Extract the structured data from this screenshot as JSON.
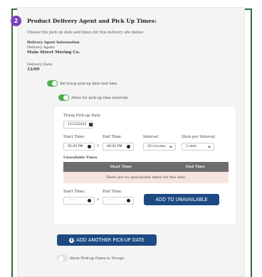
{
  "step": {
    "number": "2",
    "title": "Product Delivery Agent and Pick Up Times:"
  },
  "instructions": "Choose the pick up date and times for this delivery site below:",
  "agent": {
    "heading": "Delivery Agent Information",
    "label": "Delivery Agent:",
    "name": "Main Street Moving Co."
  },
  "delivery": {
    "label": "Delivery Date:",
    "date": "12/09"
  },
  "toggles": {
    "troop_pickup": {
      "label": "Set troop pick-up date and time",
      "on": true
    },
    "intervals": {
      "label": "Allow for pick-up time intervals",
      "on": true
    },
    "show_pickup": {
      "label": "Show Pick-up Dates to Troops",
      "on": false
    }
  },
  "pickup": {
    "date_label": "Troop Pick-up Date",
    "date_value": "12/12/2022",
    "start_label": "Start Time:",
    "end_label": "End Time:",
    "interval_label": "Interval",
    "slots_label": "Slots per Interval",
    "start_value": "05:00 PM",
    "end_value": "06:00 PM",
    "interval_value": "10 minutes",
    "slots_value": "2 slots"
  },
  "unavailable": {
    "heading": "Unavailable Times",
    "col_start": "Start Time",
    "col_end": "End Time",
    "empty_message": "There are no unavailable times for this date.",
    "start_label": "Start Time:",
    "end_label": "End Time:",
    "start_placeholder": "--:-- --",
    "end_placeholder": "--:-- --",
    "add_button": "ADD TO UNAVAILABLE"
  },
  "add_another_button": "ADD ANOTHER PICK-UP DATE",
  "icons": {
    "calendar": "calendar-icon",
    "clock": "clock-icon",
    "plus": "plus-circle-icon",
    "caret": "chevron-down-icon",
    "arrow": "chevron-right-icon"
  },
  "colors": {
    "accent_purple": "#7f3fbf",
    "toggle_green": "#4caf50",
    "button_blue": "#1d4a82",
    "frame_green": "#2e6b3a",
    "empty_row": "#f6e5df",
    "table_header": "#6d6d6d"
  }
}
